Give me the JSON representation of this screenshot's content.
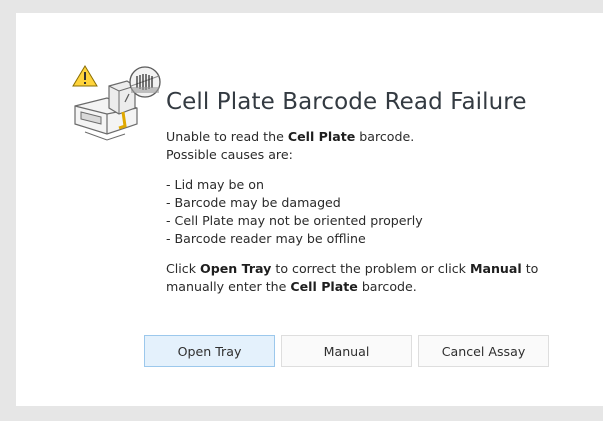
{
  "dialog": {
    "title": "Cell Plate Barcode Read Failure",
    "line1_pre": "Unable to read the ",
    "line1_bold": "Cell Plate",
    "line1_post": " barcode.",
    "line2": "Possible causes are:",
    "causes": [
      "- Lid may be on",
      "- Barcode may be damaged",
      "- Cell Plate may not be oriented properly",
      "- Barcode reader may be offline"
    ],
    "instr_pre": "Click ",
    "instr_open": "Open Tray",
    "instr_mid": " to correct the problem or click ",
    "instr_manual": "Manual",
    "instr_post": " to",
    "instr2_pre": "manually enter the ",
    "instr2_bold": "Cell Plate",
    "instr2_post": " barcode."
  },
  "buttons": {
    "open_tray": "Open Tray",
    "manual": "Manual",
    "cancel_assay": "Cancel Assay"
  },
  "icons": {
    "illustration": "instrument-warning-icon"
  },
  "colors": {
    "warning": "#f5c518",
    "accent_button_bg": "#e4f1fc",
    "accent_button_border": "#9cc8ec",
    "title": "#333a41"
  }
}
